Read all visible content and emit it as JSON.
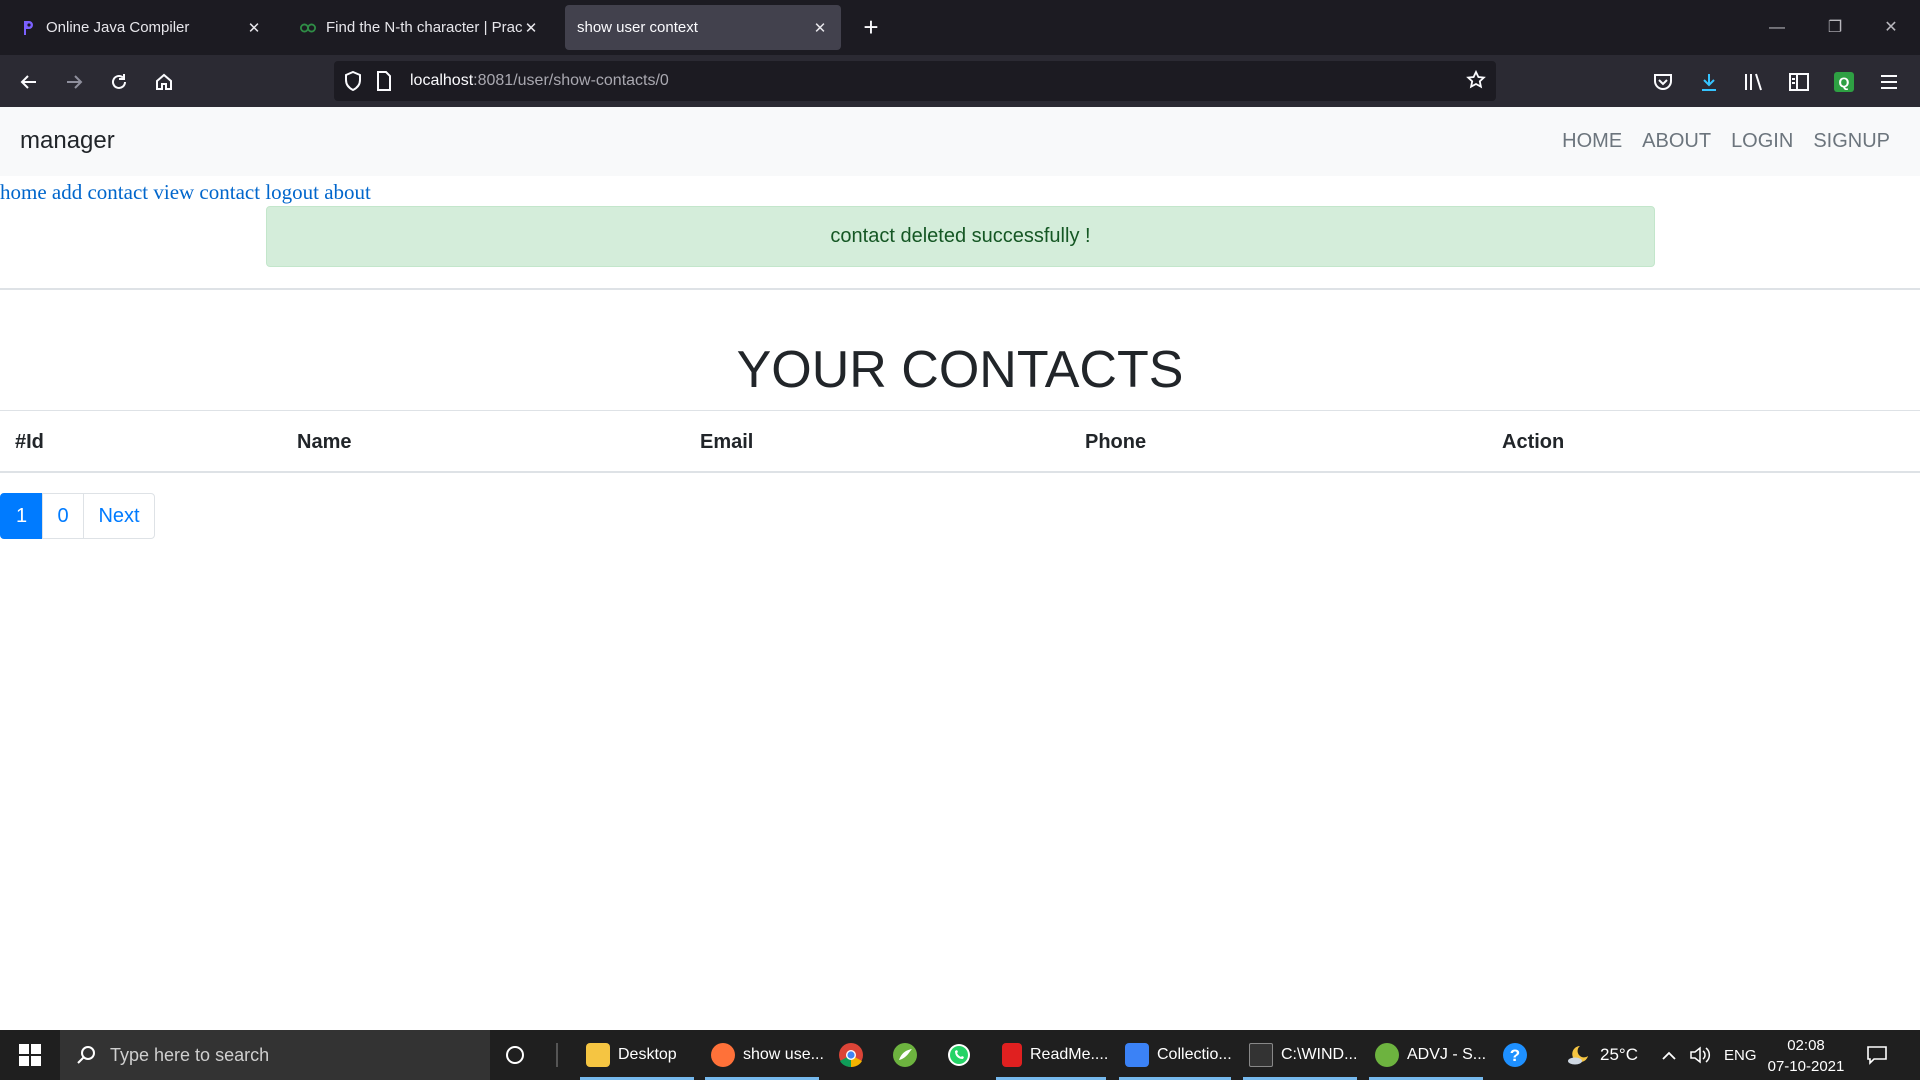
{
  "browser": {
    "tabs": [
      {
        "label": "Online Java Compiler",
        "active": false
      },
      {
        "label": "Find the N-th character | Practic",
        "active": false
      },
      {
        "label": "show user context",
        "active": true
      }
    ],
    "url_host": "localhost",
    "url_path": ":8081/user/show-contacts/0"
  },
  "app": {
    "brand": "manager",
    "menu": [
      "HOME",
      "ABOUT",
      "LOGIN",
      "SIGNUP"
    ],
    "links": [
      "home",
      "add contact",
      "view contact",
      "logout",
      "about"
    ],
    "alert": "contact deleted successfully !",
    "heading": "YOUR CONTACTS",
    "table_headers": [
      "#Id",
      "Name",
      "Email",
      "Phone",
      "Action"
    ],
    "pagination": [
      "1",
      "0",
      "Next"
    ],
    "active_page": "1"
  },
  "taskbar": {
    "search_placeholder": "Type here to search",
    "items": [
      {
        "label": "Desktop",
        "icon": "folder-icon",
        "color": "#f5c542"
      },
      {
        "label": "show use...",
        "icon": "firefox-icon",
        "color": "#ff7139"
      },
      {
        "label": "",
        "icon": "chrome-icon",
        "color": "#db4437"
      },
      {
        "label": "",
        "icon": "spring-icon",
        "color": "#6db33f"
      },
      {
        "label": "",
        "icon": "whatsapp-icon",
        "color": "#25d366"
      },
      {
        "label": "ReadMe....",
        "icon": "pdf-icon",
        "color": "#e02020"
      },
      {
        "label": "Collectio...",
        "icon": "photos-icon",
        "color": "#3b82f6"
      },
      {
        "label": "C:\\WIND...",
        "icon": "terminal-icon",
        "color": "#333333"
      },
      {
        "label": "ADVJ - S...",
        "icon": "spring-tool-icon",
        "color": "#6db33f"
      }
    ],
    "weather": "25°C",
    "language": "ENG",
    "time": "02:08",
    "date": "07-10-2021"
  }
}
